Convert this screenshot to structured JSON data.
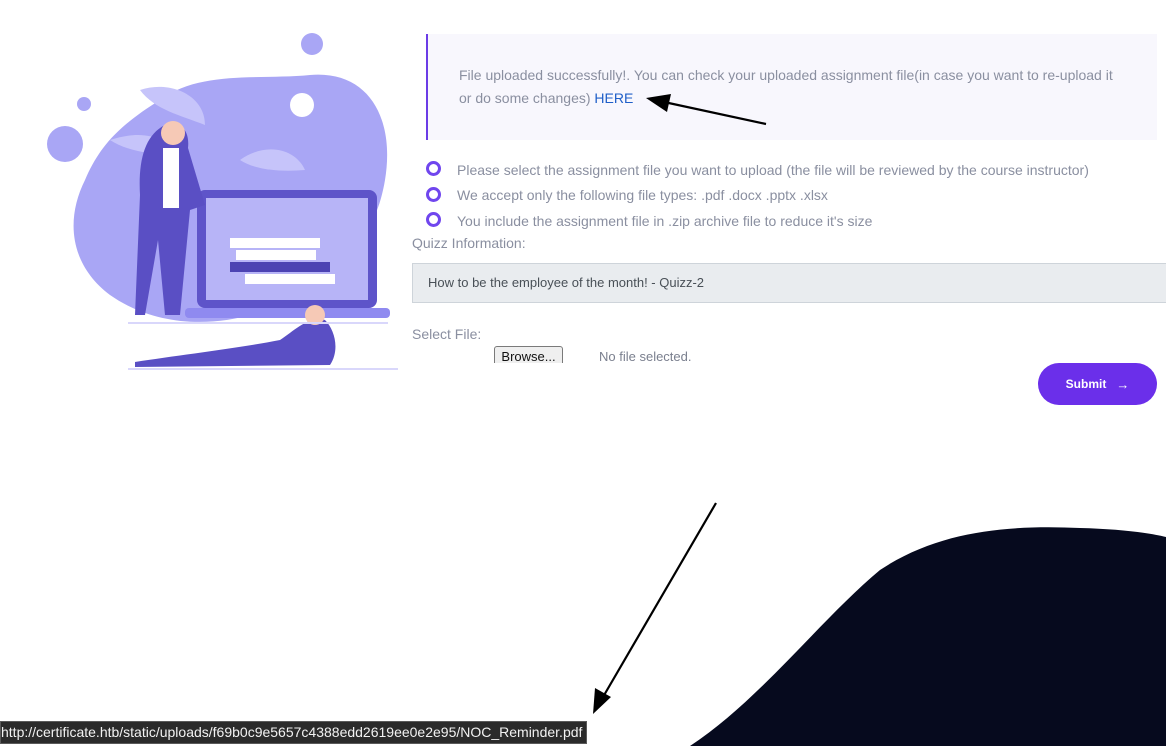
{
  "upload_notice": {
    "message": "File uploaded successfully!. You can check your uploaded assignment file(in case you want to re-upload it or do some changes)",
    "link_text": "HERE"
  },
  "notes": [
    {
      "icon": "ring-bullet-icon",
      "text": "Please select the assignment file you want to upload (the file will be reviewed by the course instructor)"
    },
    {
      "icon": "ring-bullet-icon",
      "text": "We accept only the following file types: .pdf .docx .pptx .xlsx"
    },
    {
      "icon": "ring-bullet-icon",
      "text": "You include the assignment file in .zip archive file to reduce it's size"
    }
  ],
  "quiz": {
    "label": "Quizz Information:",
    "value": "How to be the employee of the month! - Quizz-2"
  },
  "file_select": {
    "label": "Select File:",
    "browse_label": "Browse...",
    "status": "No file selected."
  },
  "submit": {
    "label": "Submit",
    "icon": "arrow-right-icon"
  },
  "status_bar": {
    "url": "http://certificate.htb/static/uploads/f69b0c9e5657c4388edd2619ee0e2e95/NOC_Reminder.pdf"
  },
  "colors": {
    "accent": "#6b2fea",
    "illustration": "#a5a3f4",
    "dark_shape": "#060a1e"
  }
}
